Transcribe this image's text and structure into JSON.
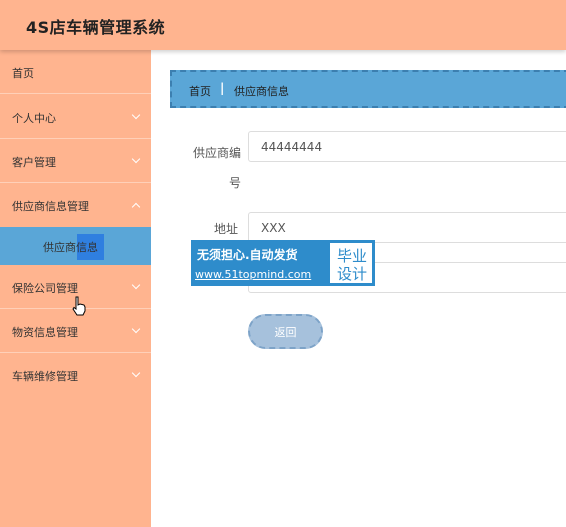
{
  "app": {
    "title": "4S店车辆管理系统"
  },
  "sidebar": {
    "items": [
      {
        "label": "首页"
      },
      {
        "label": "个人中心"
      },
      {
        "label": "客户管理"
      },
      {
        "label": "供应商信息管理"
      },
      {
        "label": "保险公司管理"
      },
      {
        "label": "物资信息管理"
      },
      {
        "label": "车辆维修管理"
      }
    ],
    "sub_items": [
      {
        "label": "供应商信息",
        "selected": true
      }
    ]
  },
  "breadcrumb": {
    "home": "首页",
    "separator": "|",
    "current": "供应商信息"
  },
  "form": {
    "fields": [
      {
        "label": "供应商编号",
        "value": "44444444"
      },
      {
        "label": "地址",
        "value": "XXX"
      },
      {
        "label": "",
        "value": ""
      }
    ],
    "back_label": "返回"
  },
  "watermark": {
    "line1": "无须担心.自动发货",
    "url": "www.51topmind.com",
    "box_line1": "毕业",
    "box_line2": "设计"
  },
  "colors": {
    "header_bg": "#ffb48f",
    "sidebar_bg": "#ffb48f",
    "selected_bg": "#5aa6d7",
    "breadcrumb_bg": "#5aa6d7",
    "button_bg": "#a6c1dc",
    "watermark_bg": "#2e8ccb"
  }
}
